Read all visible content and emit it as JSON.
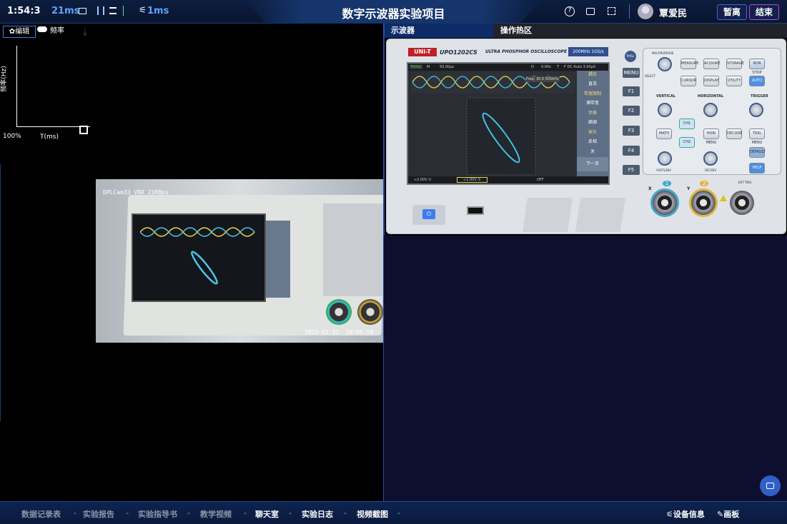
{
  "header": {
    "timer": "1:54:3",
    "latency1": "21ms",
    "latency2": "1ms",
    "title": "数字示波器实验项目",
    "user": "覃爱民",
    "pause_label": "暂离",
    "end_label": "结束"
  },
  "chart": {
    "edit_label": "编辑",
    "legend": "频率",
    "ylabel": "频率(Hz)",
    "xlabel": "T(ms)",
    "zoom": "100%"
  },
  "video": {
    "overlay": "DPLCam33 VBR 21KBps",
    "timestamp": "2025-01-22  18:05:59"
  },
  "tabs": [
    {
      "label": "示波器"
    },
    {
      "label": "操作热区"
    }
  ],
  "scope": {
    "brand": "UNI-T",
    "model": "UPO1202CS",
    "subtitle": "ULTRA PHOSPHOR OSCILLOSCOPE",
    "spec": "200MHz 1GS/s",
    "screen": {
      "trig": "TRIGD",
      "m": "M",
      "time": "50.00μs",
      "d": "D",
      "dtime": "0.00s",
      "t": "T",
      "tinfo": "F DC Auto 3.00μV",
      "freq": "Freq: 30.0 505kHz",
      "ch1": "≈2.00V ①",
      "ch2": "≈1.00V ①",
      "off": "OFF"
    },
    "menu": [
      "耦合",
      "直流",
      "带宽限制",
      "满带宽",
      "伏格",
      "细调",
      "探头",
      "反相",
      "关",
      "下一页"
    ],
    "fkeys": [
      "F1",
      "F2",
      "F3",
      "F4",
      "F5"
    ],
    "buttons": {
      "prtsc": "PrtSc",
      "menu": "MENU",
      "measure": "MEASURE",
      "acquire": "ACQUIRE",
      "storage": "STORAGE",
      "runstop": "RUN STOP",
      "cursor": "CURSOR",
      "display": "DISPLAY",
      "utility": "UTILITY",
      "auto": "AUTO",
      "math": "MATH",
      "ch1": "CH1",
      "ch2": "CH2",
      "hori": "HORI MENU",
      "decode": "DECODE",
      "trig": "TRIG MENU",
      "default": "DEFAULT",
      "help": "HELP"
    },
    "sections": {
      "multipurpose": "MULTIPURPOSE",
      "vertical": "VERTICAL",
      "horizontal": "HORIZONTAL",
      "trigger": "TRIGGER",
      "select": "SELECT",
      "voltsdiv": "VOLTS/DIV",
      "secdiv": "SEC/DIV"
    },
    "inputs": {
      "x": "X",
      "y": "Y",
      "one": "1",
      "two": "2",
      "ext": "EXT TRIG"
    }
  },
  "footer": {
    "items": [
      "数据记录表",
      "实验报告",
      "实验指导书",
      "教学视频",
      "聊天室",
      "实验日志",
      "视频截图"
    ],
    "device_info": "设备信息",
    "board": "画板"
  },
  "colors": {
    "accent": "#3c7df0",
    "cyan": "#1ec8e0",
    "yellow": "#e8d84a"
  }
}
